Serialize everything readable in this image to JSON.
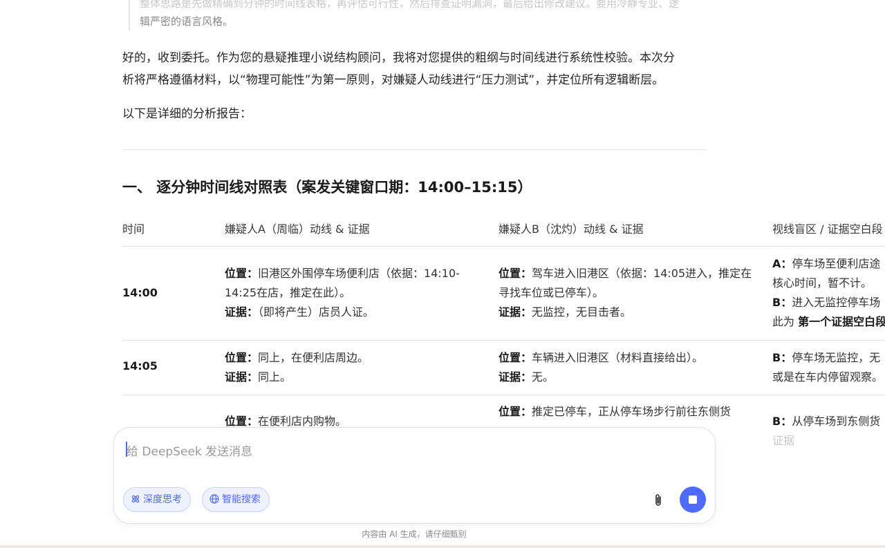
{
  "quote": {
    "line1": "整体思路是先做精确到分钟的时间线表格，再评估可行性，然后排查证明漏洞，最后给出修改建议。要用冷静专业、逻",
    "line2": "辑严密的语言风格。"
  },
  "intro": {
    "p1a": "好的，收到委托。作为您的悬疑推理小说结构顾问，我将对您提供的粗纲与时间线进行系统性校验。本次分",
    "p1b": "析将严格遵循材料，以“物理可能性”为第一原则，对嫌疑人动线进行“压力测试”，并定位所有逻辑断层。",
    "p2": "以下是详细的分析报告："
  },
  "section": {
    "title": "一、 逐分钟时间线对照表（案发关键窗口期：14:00–15:15）"
  },
  "table": {
    "headers": [
      "时间",
      "嫌疑人A（周临）动线 & 证据",
      "嫌疑人B（沈灼）动线 & 证据",
      "视线盲区 / 证据空白段"
    ],
    "rows": [
      {
        "time": "14:00",
        "a_pos_label": "位置：",
        "a_pos": "旧港区外围停车场便利店（依据：14:10-14:25在店，推定在此）。",
        "a_ev_label": "证据：",
        "a_ev": "（即将产生）店员人证。",
        "b_pos_label": "位置：",
        "b_pos": "驾车进入旧港区（依据：14:05进入，推定在寻找车位或已停车）。",
        "b_ev_label": "证据：",
        "b_ev": "无监控，无目击者。",
        "blind_a_label": "A：",
        "blind_a": "停车场至便利店途",
        "blind_a2": "核心时间，暂不计。",
        "blind_b_label": "B：",
        "blind_b": "进入无监控停车场",
        "blind_b2_pre": "此为",
        "blind_b2_bold": "第一个证据空白段"
      },
      {
        "time": "14:05",
        "a_pos_label": "位置：",
        "a_pos": "同上，在便利店周边。",
        "a_ev_label": "证据：",
        "a_ev": "同上。",
        "b_pos_label": "位置：",
        "b_pos": "车辆进入旧港区（材料直接给出）。",
        "b_ev_label": "证据：",
        "b_ev": "无。",
        "blind_b_label": "B：",
        "blind_b": "停车场无监控，无",
        "blind_b2": "或是在车内停留观察。"
      },
      {
        "a_pos_label": "位置：",
        "a_pos": "在便利店内购物。",
        "b_pos_label": "位置：",
        "b_pos": "推定已停车，正从停车场步行前往东侧货",
        "blind_b_label": "B：",
        "blind_b": "从停车场到东侧货",
        "blind_b2": "证据"
      }
    ]
  },
  "composer": {
    "placeholder": "给 DeepSeek 发送消息",
    "deep_think": "深度思考",
    "web_search": "智能搜索"
  },
  "disclaimer": "内容由 AI 生成，请仔细甄别",
  "colors": {
    "accent": "#4d6bfe",
    "pill_bg": "#eef2ff"
  }
}
